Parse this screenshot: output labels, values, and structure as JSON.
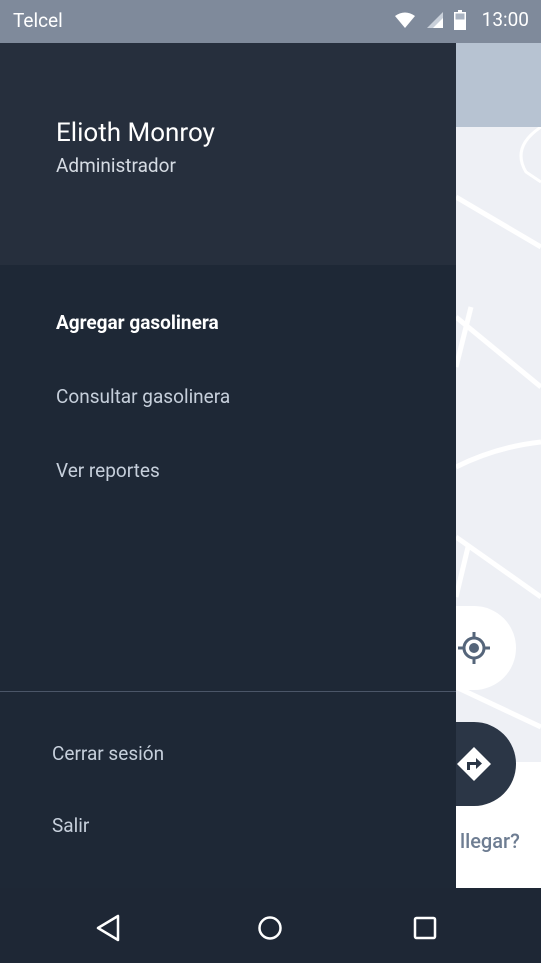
{
  "status_bar": {
    "carrier": "Telcel",
    "time": "13:00",
    "icons": [
      "wifi-icon",
      "signal-icon",
      "battery-icon"
    ]
  },
  "drawer": {
    "user_name": "Elioth Monroy",
    "user_role": "Administrador",
    "menu": [
      {
        "label": "Agregar gasolinera",
        "active": true
      },
      {
        "label": "Consultar gasolinera",
        "active": false
      },
      {
        "label": "Ver reportes",
        "active": false
      }
    ],
    "bottom_menu": [
      {
        "label": "Cerrar sesión"
      },
      {
        "label": "Salir"
      }
    ]
  },
  "map_peek": {
    "partial_text": "llegar?",
    "buttons": [
      "my-location-icon",
      "directions-icon"
    ]
  },
  "nav_bar": {
    "buttons": [
      "back-icon",
      "home-icon",
      "recents-icon"
    ]
  },
  "colors": {
    "drawer_bg": "#1e2836",
    "header_bg": "#262f3d",
    "status_bar": "#7f8a9b",
    "map_bg": "#eef0f5"
  }
}
